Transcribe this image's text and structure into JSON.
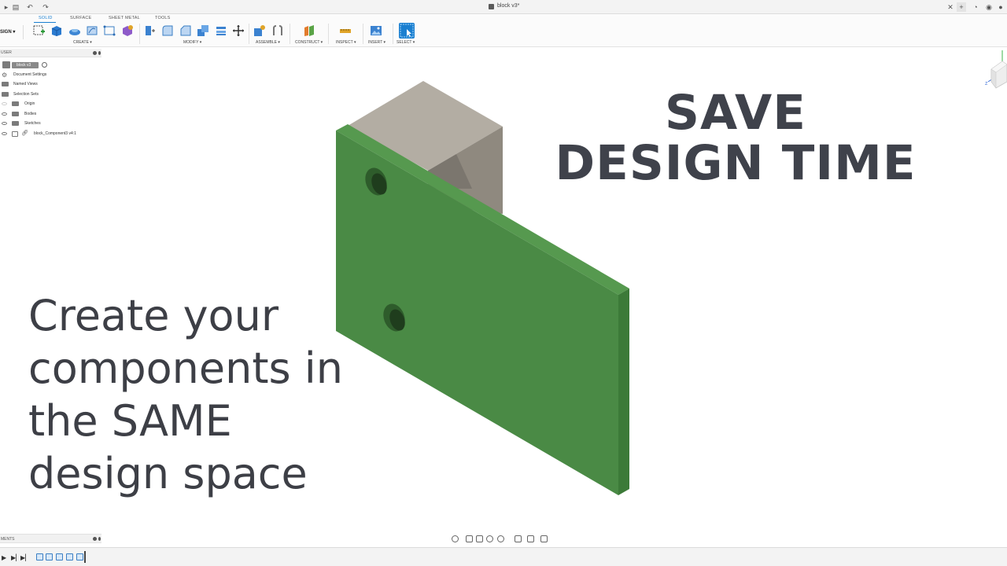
{
  "window": {
    "document_title": "block v3*"
  },
  "toolbar": {
    "workspace": "SIGN",
    "tabs": [
      {
        "label": "SOLID",
        "active": true
      },
      {
        "label": "SURFACE",
        "active": false
      },
      {
        "label": "SHEET METAL",
        "active": false
      },
      {
        "label": "TOOLS",
        "active": false
      }
    ],
    "groups": [
      {
        "label": "CREATE ▾"
      },
      {
        "label": "MODIFY ▾"
      },
      {
        "label": "ASSEMBLE ▾"
      },
      {
        "label": "CONSTRUCT ▾"
      },
      {
        "label": "INSPECT ▾"
      },
      {
        "label": "INSERT ▾"
      },
      {
        "label": "SELECT ▾"
      }
    ],
    "accent_color": "#1a7fd0"
  },
  "browser": {
    "title": "USER",
    "root": "block v3",
    "items": [
      {
        "label": "Document Settings",
        "icon": "gear-icon"
      },
      {
        "label": "Named Views",
        "icon": "folder-icon"
      },
      {
        "label": "Selection Sets",
        "icon": "folder-icon"
      },
      {
        "label": "Origin",
        "icon": "folder-icon"
      },
      {
        "label": "Bodies",
        "icon": "folder-icon"
      },
      {
        "label": "Sketches",
        "icon": "folder-icon"
      },
      {
        "label": "block_Component3 v4:1",
        "icon": "link-icon"
      }
    ]
  },
  "headline": {
    "line1": "SAVE",
    "line2": "DESIGN TIME"
  },
  "subhead": {
    "line1": "Create your",
    "line2": "components in",
    "line3": "the SAME",
    "line4": "design space"
  },
  "model": {
    "plate_color": "#4a8a45",
    "plate_edge_color": "#3c7a38",
    "block_top_color": "#b3ada3",
    "block_side_color": "#8f897f"
  },
  "comments": {
    "title": "MENTS"
  }
}
